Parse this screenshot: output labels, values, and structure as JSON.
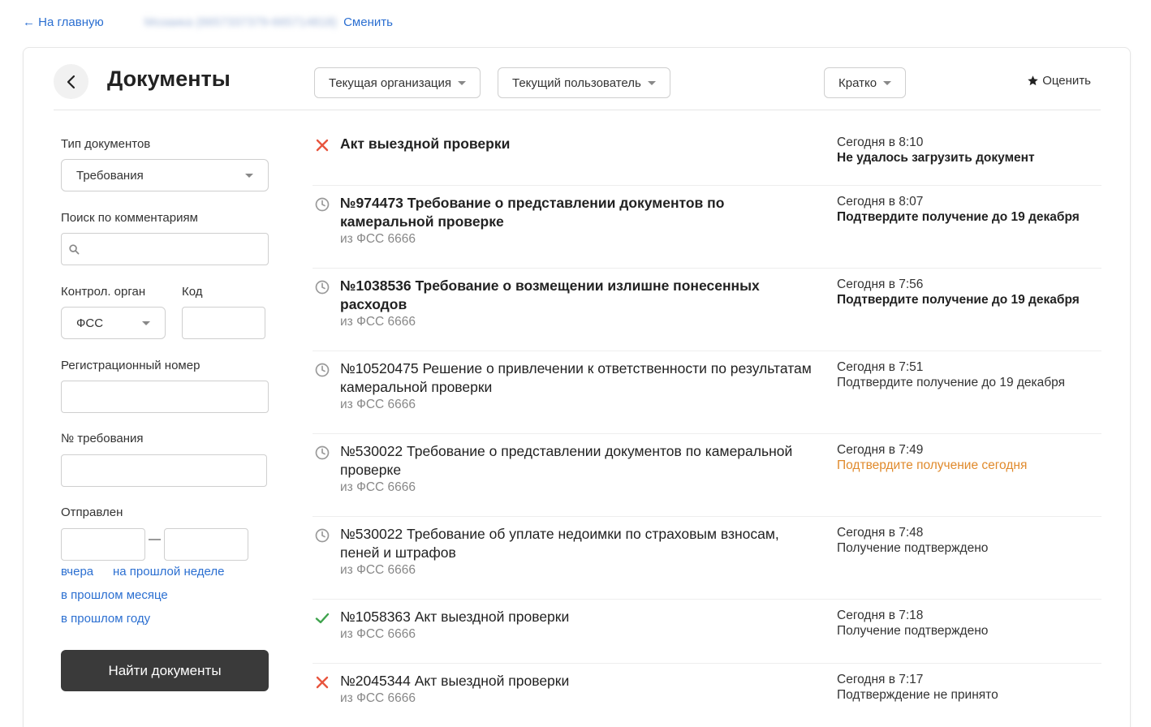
{
  "topbar": {
    "back_home": "← На главную",
    "org_name": "Мозаика (6657337379-665714818)",
    "change": "Сменить"
  },
  "header": {
    "title": "Документы",
    "filter_org": "Текущая организация",
    "filter_user": "Текущий пользователь",
    "view_mode": "Кратко",
    "rate": "Оценить"
  },
  "filters": {
    "doc_type_label": "Тип документов",
    "doc_type_value": "Требования",
    "comment_search_label": "Поиск по комментариям",
    "comment_search_value": "",
    "control_body_label": "Контрол. орган",
    "control_body_value": "ФСС",
    "code_label": "Код",
    "code_value": "",
    "reg_number_label": "Регистрационный номер",
    "reg_number_value": "",
    "requirement_number_label": "№ требования",
    "requirement_number_value": "",
    "sent_label": "Отправлен",
    "date_from": "",
    "date_to": "",
    "dash": "—",
    "quick_yesterday": "вчера",
    "quick_last_week": "на прошлой неделе",
    "quick_last_month": "в прошлом месяце",
    "quick_last_year": "в прошлом году",
    "find_button": "Найти документы"
  },
  "documents": [
    {
      "status_icon": "error-x-icon",
      "title": "Акт выездной проверки",
      "sender": "",
      "bold": true,
      "time": "Сегодня в 8:10",
      "status": "Не удалось загрузить документ",
      "status_style": "bold"
    },
    {
      "status_icon": "clock-icon",
      "title": "№974473 Требование о представлении документов по камеральной проверке",
      "sender": "из ФСС 6666",
      "bold": true,
      "time": "Сегодня в 8:07",
      "status": "Подтвердите получение до 19 декабря",
      "status_style": "bold"
    },
    {
      "status_icon": "clock-icon",
      "title": "№1038536 Требование о возмещении излишне понесенных расходов",
      "sender": "из ФСС 6666",
      "bold": true,
      "time": "Сегодня в 7:56",
      "status": "Подтвердите получение до 19 декабря",
      "status_style": "bold"
    },
    {
      "status_icon": "clock-icon",
      "title": "№10520475 Решение о привлечении к ответственности по результатам камеральной проверки",
      "sender": "из ФСС 6666",
      "bold": false,
      "time": "Сегодня в 7:51",
      "status": "Подтвердите получение до 19 декабря",
      "status_style": "normal"
    },
    {
      "status_icon": "clock-icon",
      "title": "№530022 Требование о представлении документов по камеральной проверке",
      "sender": "из ФСС 6666",
      "bold": false,
      "time": "Сегодня в 7:49",
      "status": "Подтвердите получение сегодня",
      "status_style": "warn"
    },
    {
      "status_icon": "clock-icon",
      "title": "№530022 Требование об уплате недоимки по страховым взносам, пеней и штрафов",
      "sender": "из ФСС 6666",
      "bold": false,
      "time": "Сегодня в 7:48",
      "status": "Получение подтверждено",
      "status_style": "normal"
    },
    {
      "status_icon": "check-icon",
      "title": "№1058363 Акт выездной проверки",
      "sender": "из ФСС 6666",
      "bold": false,
      "time": "Сегодня в 7:18",
      "status": "Получение подтверждено",
      "status_style": "normal"
    },
    {
      "status_icon": "error-x-icon",
      "title": "№2045344 Акт выездной проверки",
      "sender": "из ФСС 6666",
      "bold": false,
      "time": "Сегодня в 7:17",
      "status": "Подтверждение не принято",
      "status_style": "normal"
    }
  ],
  "colors": {
    "link": "#2b6fd1",
    "error": "#e8553e",
    "success": "#3fa34d",
    "clock": "#9a9a9a",
    "warning": "#e08a2c",
    "primary_button": "#3a3a3a"
  }
}
